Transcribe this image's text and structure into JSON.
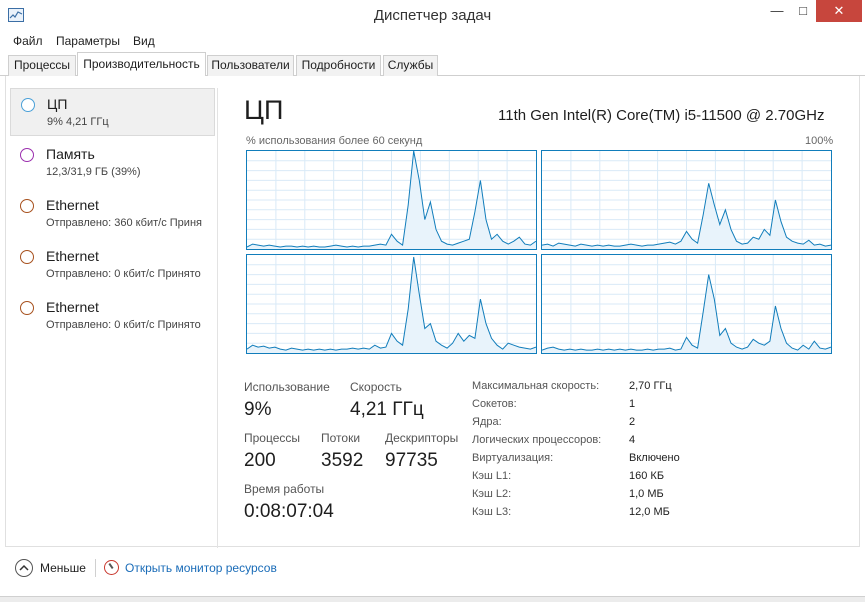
{
  "window": {
    "title": "Диспетчер задач",
    "minimize": "—",
    "maximize": "□",
    "close": "✕"
  },
  "menu": [
    "Файл",
    "Параметры",
    "Вид"
  ],
  "tabs": [
    "Процессы",
    "Производительность",
    "Пользователи",
    "Подробности",
    "Службы"
  ],
  "active_tab": "Производительность",
  "sidebar": {
    "items": [
      {
        "name": "ЦП",
        "sub": "9% 4,21 ГГц",
        "icon": "circle-blue",
        "color": "#4aa0d8",
        "selected": true
      },
      {
        "name": "Память",
        "sub": "12,3/31,9 ГБ (39%)",
        "icon": "circle-purple",
        "color": "#9b2fae",
        "selected": false
      },
      {
        "name": "Ethernet",
        "sub": "Отправлено: 360 кбит/с Приня",
        "icon": "circle-orange",
        "color": "#a7511e",
        "selected": false
      },
      {
        "name": "Ethernet",
        "sub": "Отправлено: 0 кбит/с Принято",
        "icon": "circle-orange",
        "color": "#a7511e",
        "selected": false
      },
      {
        "name": "Ethernet",
        "sub": "Отправлено: 0 кбит/с Принято",
        "icon": "circle-orange",
        "color": "#a7511e",
        "selected": false
      }
    ]
  },
  "cpu": {
    "title": "ЦП",
    "model": "11th Gen Intel(R) Core(TM) i5-11500 @ 2.70GHz",
    "graph_label": "% использования более 60 секунд",
    "graph_max": "100%",
    "graph_color": "#117dbb",
    "graphs": [
      [
        2,
        5,
        4,
        3,
        4,
        3,
        2,
        3,
        3,
        2,
        3,
        2,
        3,
        2,
        2,
        3,
        4,
        3,
        2,
        3,
        2,
        3,
        3,
        4,
        5,
        4,
        15,
        8,
        4,
        45,
        100,
        70,
        30,
        48,
        20,
        8,
        5,
        4,
        6,
        8,
        10,
        38,
        70,
        30,
        10,
        15,
        8,
        5,
        8,
        12,
        5,
        4,
        8
      ],
      [
        4,
        5,
        3,
        6,
        5,
        4,
        3,
        5,
        4,
        3,
        4,
        3,
        4,
        3,
        3,
        4,
        5,
        4,
        3,
        4,
        4,
        5,
        6,
        7,
        5,
        8,
        18,
        10,
        6,
        35,
        67,
        45,
        25,
        40,
        20,
        8,
        5,
        6,
        12,
        10,
        20,
        14,
        50,
        28,
        12,
        8,
        6,
        5,
        9,
        4,
        5,
        3,
        4
      ],
      [
        4,
        8,
        6,
        7,
        5,
        6,
        4,
        3,
        5,
        4,
        3,
        4,
        3,
        4,
        3,
        4,
        3,
        4,
        4,
        5,
        4,
        5,
        4,
        8,
        5,
        6,
        20,
        12,
        8,
        45,
        98,
        60,
        25,
        30,
        12,
        8,
        5,
        10,
        20,
        12,
        18,
        15,
        55,
        30,
        15,
        8,
        4,
        10,
        8,
        6,
        5,
        4,
        6
      ],
      [
        3,
        5,
        6,
        4,
        3,
        4,
        3,
        4,
        3,
        3,
        4,
        3,
        4,
        3,
        4,
        3,
        4,
        3,
        3,
        4,
        3,
        4,
        4,
        5,
        3,
        4,
        16,
        8,
        5,
        42,
        80,
        55,
        18,
        25,
        10,
        6,
        4,
        6,
        14,
        10,
        8,
        12,
        48,
        25,
        10,
        5,
        3,
        8,
        4,
        12,
        5,
        4,
        6
      ]
    ]
  },
  "stats": {
    "usage_label": "Использование",
    "usage_value": "9%",
    "speed_label": "Скорость",
    "speed_value": "4,21 ГГц",
    "processes_label": "Процессы",
    "processes_value": "200",
    "threads_label": "Потоки",
    "threads_value": "3592",
    "handles_label": "Дескрипторы",
    "handles_value": "97735",
    "uptime_label": "Время работы",
    "uptime_value": "0:08:07:04"
  },
  "specs": [
    {
      "label": "Максимальная скорость:",
      "value": "2,70 ГГц"
    },
    {
      "label": "Сокетов:",
      "value": "1"
    },
    {
      "label": "Ядра:",
      "value": "2"
    },
    {
      "label": "Логических процессоров:",
      "value": "4"
    },
    {
      "label": "Виртуализация:",
      "value": "Включено"
    },
    {
      "label": "Кэш L1:",
      "value": "160 КБ"
    },
    {
      "label": "Кэш L2:",
      "value": "1,0 МБ"
    },
    {
      "label": "Кэш L3:",
      "value": "12,0 МБ"
    }
  ],
  "footer": {
    "fewer_label": "Меньше",
    "monitor_link": "Открыть монитор ресурсов"
  }
}
